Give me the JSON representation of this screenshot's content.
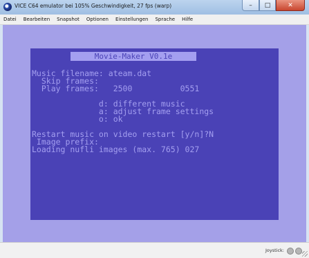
{
  "window": {
    "title": "VICE C64 emulator bei 105% Geschwindigkeit, 27 fps (warp)",
    "icon": "vice-c64-icon",
    "controls": {
      "minimize": "–",
      "maximize": "□",
      "close": "✕"
    }
  },
  "menu": [
    "Datei",
    "Bearbeiten",
    "Snapshot",
    "Optionen",
    "Einstellungen",
    "Sprache",
    "Hilfe"
  ],
  "c64": {
    "header": "Movie-Maker V0.1e",
    "lines": [
      "Music filename: ateam.dat",
      "  Skip frames:",
      "  Play frames:   2500          0551",
      "",
      "              d: different music",
      "              a: adjust frame settings",
      "              o: ok",
      "",
      "Restart music on video restart [y/n]?N",
      " Image prefix:",
      "Loading nufli images (max. 765) 027"
    ]
  },
  "status": {
    "joystick_label": "Joystick:",
    "icons": [
      "joystick-port-1-icon",
      "joystick-port-2-icon"
    ]
  },
  "colors": {
    "c64_border": "#a4a0e8",
    "c64_background": "#4a42b6",
    "c64_text": "#a49ff0"
  }
}
